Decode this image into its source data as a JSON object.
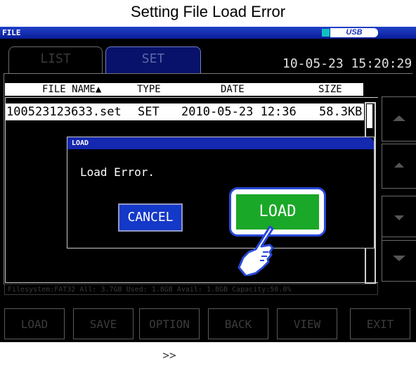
{
  "caption": "Setting File Load Error",
  "header": {
    "label": "FILE",
    "usb_label": "USB"
  },
  "tabs": {
    "list": "LIST",
    "set": "SET"
  },
  "clock": "10-05-23 15:20:29",
  "list": {
    "columns": {
      "file_name": "FILE NAME▲",
      "type": "TYPE",
      "date": "DATE",
      "size": "SIZE"
    },
    "row": {
      "name": "100523123633.set",
      "type": "SET",
      "date": "2010-05-23 12:36",
      "size": "58.3KB"
    }
  },
  "filesystem": "Filesystem:FAT32 All: 3.7GB Used: 1.8GB Avail: 1.8GB Capacity:50.0%",
  "dialog": {
    "title": "LOAD",
    "message": "Load Error.",
    "cancel_label": "CANCEL",
    "load_label": "LOAD"
  },
  "footer": [
    "LOAD",
    "SAVE",
    "OPTION >>",
    "BACK",
    "VIEW",
    "EXIT"
  ],
  "icons": {
    "side_buttons": [
      "double-up-icon",
      "up-icon",
      "down-icon",
      "double-down-icon"
    ],
    "pointer": "hand-pointer-icon"
  },
  "colors": {
    "titlebar": "#0a1e98",
    "load_button": "#1aa828",
    "cancel_button": "#1438c8"
  }
}
